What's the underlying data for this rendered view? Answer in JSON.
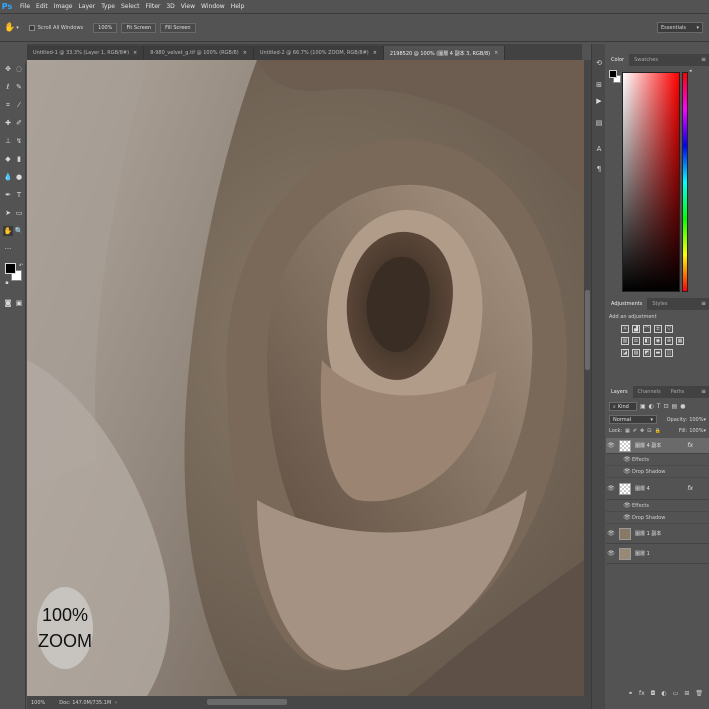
{
  "app": {
    "logo": "Ps"
  },
  "menu": [
    "File",
    "Edit",
    "Image",
    "Layer",
    "Type",
    "Select",
    "Filter",
    "3D",
    "View",
    "Window",
    "Help"
  ],
  "options_bar": {
    "scroll_all_windows": "Scroll All Windows",
    "buttons": [
      "100%",
      "Fit Screen",
      "Fill Screen"
    ],
    "workspace": "Essentials"
  },
  "tabs": [
    {
      "label": "Untitled-1 @ 33.3% (Layer 1, RGB/8#)",
      "active": false
    },
    {
      "label": "8-980_velvet_g.tif @ 100% (RGB/8)",
      "active": false
    },
    {
      "label": "Untitled-2 @ 66.7% (100% ZOOM, RGB/8#)",
      "active": false
    },
    {
      "label": "2198520 @ 100% (圖層 4 副本 3, RGB/8)",
      "active": true
    }
  ],
  "canvas": {
    "zoom_badge_line1": "100%",
    "zoom_badge_line2": "ZOOM"
  },
  "status": {
    "zoom": "100%",
    "doc": "Doc: 147.0M/735.1M"
  },
  "color_panel": {
    "tabs": [
      "Color",
      "Swatches"
    ]
  },
  "adjustments_panel": {
    "tabs": [
      "Adjustments",
      "Styles"
    ],
    "hint": "Add an adjustment"
  },
  "layers_panel": {
    "tabs": [
      "Layers",
      "Channels",
      "Paths"
    ],
    "filter_kind": "Kind",
    "blend_mode": "Normal",
    "opacity_label": "Opacity:",
    "opacity_value": "100%",
    "lock_label": "Lock:",
    "fill_label": "Fill:",
    "fill_value": "100%",
    "layers": [
      {
        "name": "圖層 4 副本",
        "fx": "fx",
        "effects": "Effects",
        "effect_item": "Drop Shadow"
      },
      {
        "name": "圖層 4",
        "fx": "fx",
        "effects": "Effects",
        "effect_item": "Drop Shadow"
      },
      {
        "name": "圖層 1 副本"
      },
      {
        "name": "圖層 1"
      }
    ]
  },
  "colors": {
    "accent": "#31a8ff",
    "panel_bg": "#535353",
    "dark_bg": "#424242",
    "foreground_swatch": "#000000",
    "background_swatch": "#ffffff"
  }
}
